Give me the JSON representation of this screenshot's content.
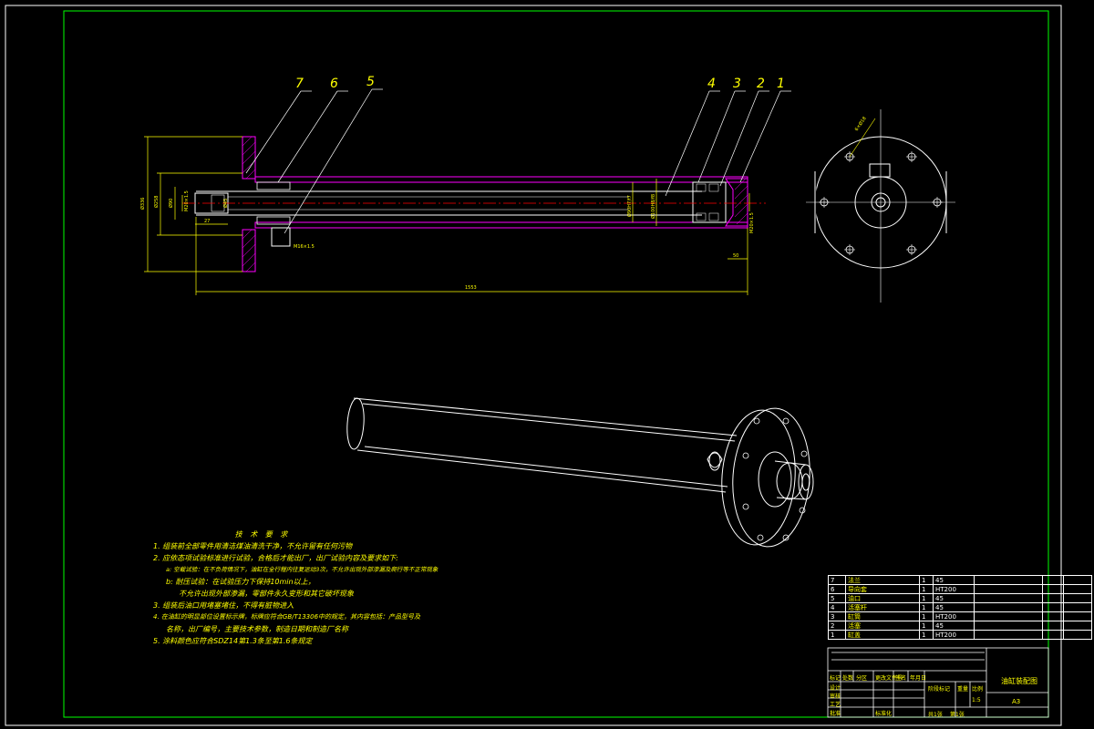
{
  "callouts": [
    {
      "id": "7",
      "label": "7"
    },
    {
      "id": "6",
      "label": "6"
    },
    {
      "id": "5",
      "label": "5"
    },
    {
      "id": "4",
      "label": "4"
    },
    {
      "id": "3",
      "label": "3"
    },
    {
      "id": "2",
      "label": "2"
    },
    {
      "id": "1",
      "label": "1"
    }
  ],
  "dimensions": {
    "total_length": "1553",
    "flange_dia": "Ø336",
    "dim_a": "Ø258",
    "dim_b": "Ø90",
    "dim_c": "M20×1.5",
    "dim_d": "Ø45",
    "dim_e": "27",
    "dim_f": "Ø90H7/f7",
    "dim_g": "Ø100H8/f8",
    "dim_h": "M16×1.5",
    "dim_i": "M20×1.5",
    "dim_j": "50",
    "hole_note": "6×Ø18"
  },
  "notes": {
    "title": "技 术 要 求",
    "lines": [
      "1. 组装前全部零件用清洁煤油清洗干净，不允许留有任何污物",
      "2. 应依态项试验标准进行试验，合格后才能出厂，出厂试验内容及要求如下:",
      "a: 空载试验：在不负荷情况下，油缸在全行程内往复运动3次，不允许出现外部渗漏及爬行等不正常现象",
      "b: 耐压试验：在试验压力下保持10min以上，",
      "不允许出现外部渗漏，零部件永久变形和其它破坏现象",
      "3. 组装后油口用堵塞堵住，不得有脏物进入",
      "4. 在油缸的明显部位设置标示牌，标牌应符合GB/T13306中的规定，其内容包括：产品型号及",
      "名称，出厂编号，主要技术参数，制造日期和制造厂名称",
      "5. 涂料颜色应符合SDZ14第1.3条至第1.6条规定"
    ]
  },
  "bom": [
    {
      "no": "7",
      "name": "法兰",
      "qty": "1",
      "material": "45"
    },
    {
      "no": "6",
      "name": "导向套",
      "qty": "1",
      "material": "HT200"
    },
    {
      "no": "5",
      "name": "油口",
      "qty": "1",
      "material": "45"
    },
    {
      "no": "4",
      "name": "活塞杆",
      "qty": "1",
      "material": "45"
    },
    {
      "no": "3",
      "name": "缸筒",
      "qty": "1",
      "material": "HT200"
    },
    {
      "no": "2",
      "name": "活塞",
      "qty": "1",
      "material": "45"
    },
    {
      "no": "1",
      "name": "缸盖",
      "qty": "1",
      "material": "HT200"
    }
  ],
  "title_block": {
    "drawing_title": "油缸装配图",
    "scale_label": "A3",
    "row_labels": [
      "标记",
      "处数",
      "分区",
      "更改文件号",
      "签名",
      "年月日"
    ],
    "left_labels": [
      "设计",
      "审核",
      "工艺",
      "标准化",
      "批准"
    ],
    "right_labels": [
      "阶段标记",
      "重量",
      "比例",
      "共1张",
      "第1张"
    ],
    "scale_value": "1:5"
  },
  "colors": {
    "background": "#000000",
    "border": "#ffffff",
    "outline": "#ffff00",
    "centerline": "#ff0000",
    "hatch": "#ff00ff",
    "body": "#ffffff"
  }
}
